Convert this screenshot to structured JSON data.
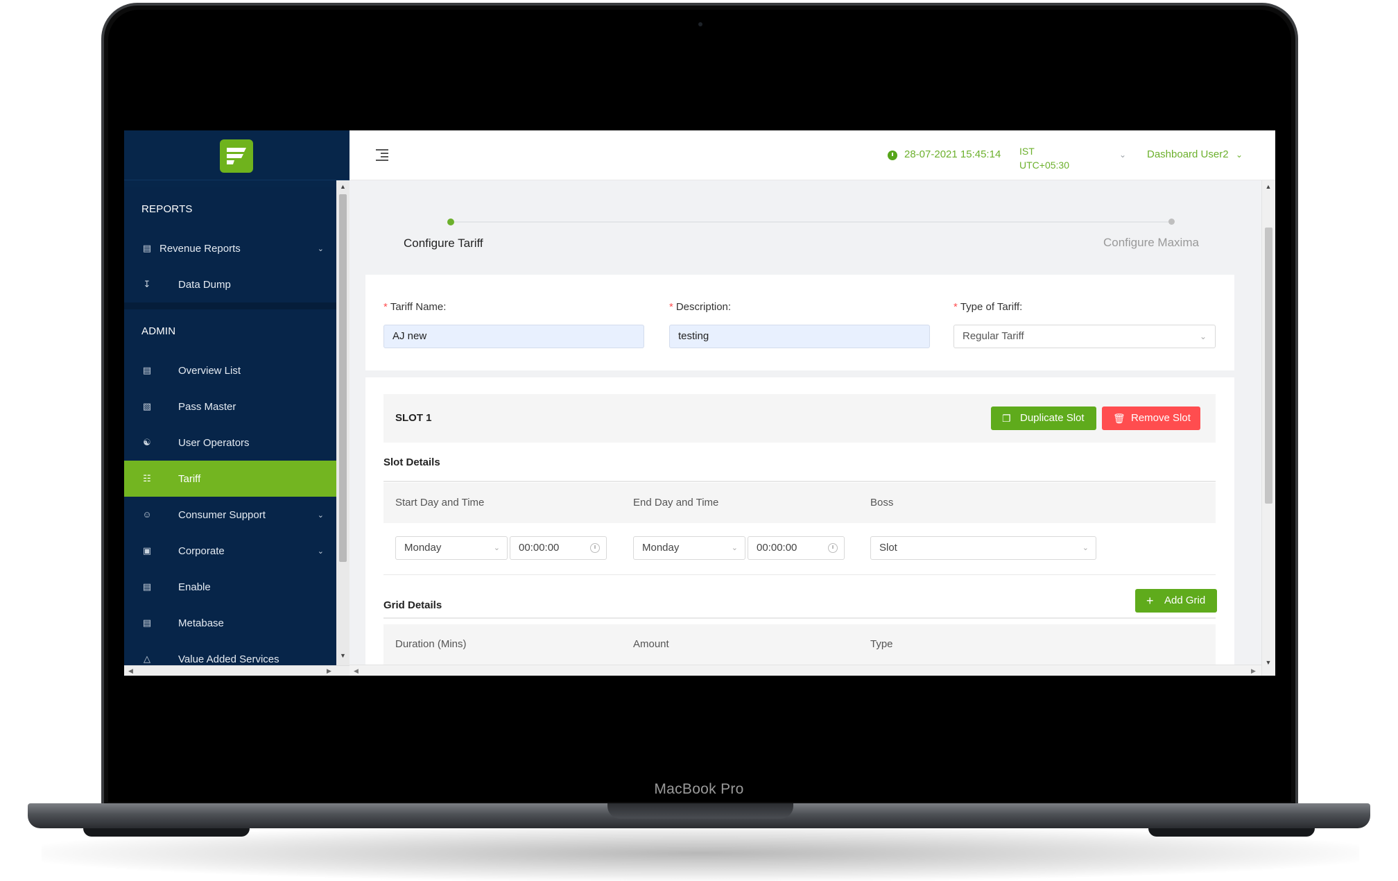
{
  "device": {
    "label": "MacBook Pro"
  },
  "sidebar": {
    "sections": [
      {
        "title": "REPORTS",
        "items": [
          {
            "label": "Revenue Reports",
            "icon": "bar-chart-icon",
            "has_submenu": true
          },
          {
            "label": "Data Dump",
            "icon": "download-icon",
            "has_submenu": false
          }
        ]
      },
      {
        "title": "ADMIN",
        "items": [
          {
            "label": "Overview List",
            "icon": "list-icon",
            "has_submenu": false
          },
          {
            "label": "Pass Master",
            "icon": "id-card-icon",
            "has_submenu": false
          },
          {
            "label": "User Operators",
            "icon": "users-icon",
            "has_submenu": false
          },
          {
            "label": "Tariff",
            "icon": "tariff-icon",
            "has_submenu": false,
            "active": true
          },
          {
            "label": "Consumer Support",
            "icon": "user-icon",
            "has_submenu": true
          },
          {
            "label": "Corporate",
            "icon": "briefcase-icon",
            "has_submenu": true
          },
          {
            "label": "Enable",
            "icon": "table-icon",
            "has_submenu": false
          },
          {
            "label": "Metabase",
            "icon": "list-icon",
            "has_submenu": false
          },
          {
            "label": "Value Added Services",
            "icon": "star-icon",
            "has_submenu": false
          }
        ]
      }
    ]
  },
  "header": {
    "datetime": "28-07-2021 15:45:14",
    "timezone_line1": "IST",
    "timezone_line2": "UTC+05:30",
    "user": "Dashboard User2"
  },
  "steps": [
    {
      "label": "Configure Tariff",
      "state": "active"
    },
    {
      "label": "Configure Maxima",
      "state": "pending"
    }
  ],
  "form": {
    "tariff_name": {
      "label": "Tariff Name",
      "value": "AJ new"
    },
    "description": {
      "label": "Description",
      "value": "testing"
    },
    "type_of_tariff": {
      "label": "Type of Tariff",
      "value": "Regular Tariff"
    }
  },
  "slot": {
    "title": "SLOT 1",
    "duplicate_label": "Duplicate Slot",
    "remove_label": "Remove Slot",
    "details_title": "Slot Details",
    "columns": [
      "Start Day and Time",
      "End Day and Time",
      "Boss"
    ],
    "start_day": "Monday",
    "start_time": "00:00:00",
    "end_day": "Monday",
    "end_time": "00:00:00",
    "boss": "Slot"
  },
  "grid": {
    "title": "Grid Details",
    "add_label": "Add Grid",
    "columns": [
      "Duration (Mins)",
      "Amount",
      "Type"
    ]
  },
  "colors": {
    "accent": "#73b521",
    "danger": "#ff4d4f",
    "sidebar_bg": "#07264a"
  }
}
